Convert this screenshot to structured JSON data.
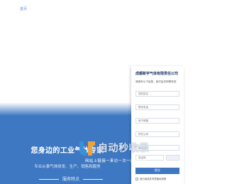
{
  "nav": {
    "home": "首页"
  },
  "hero": {
    "title": "您身边的工业气体专家",
    "subtitle": "专业从事气体研发、生产、销售和服务",
    "service_label": "服务特点"
  },
  "form": {
    "title": "成都新宇气体有限责任公司",
    "description": "请填写以下信息，我们会尽快联系您",
    "fields": [
      "您的姓名",
      "联系电话",
      "电子邮箱",
      "所在公司",
      "留言内容"
    ],
    "captcha_placeholder": "验证码",
    "submit_label": "提交",
    "privacy": "我已阅读并同意隐私政策"
  },
  "watermark": {
    "text": "自动秒收录",
    "sub": "网站上链接一来访一次一自动收录",
    "colors": {
      "left": "#3a8fd9",
      "right": "#f0a23a"
    }
  },
  "colors": {
    "brand": "#3e78c2",
    "title": "#1a3566"
  }
}
